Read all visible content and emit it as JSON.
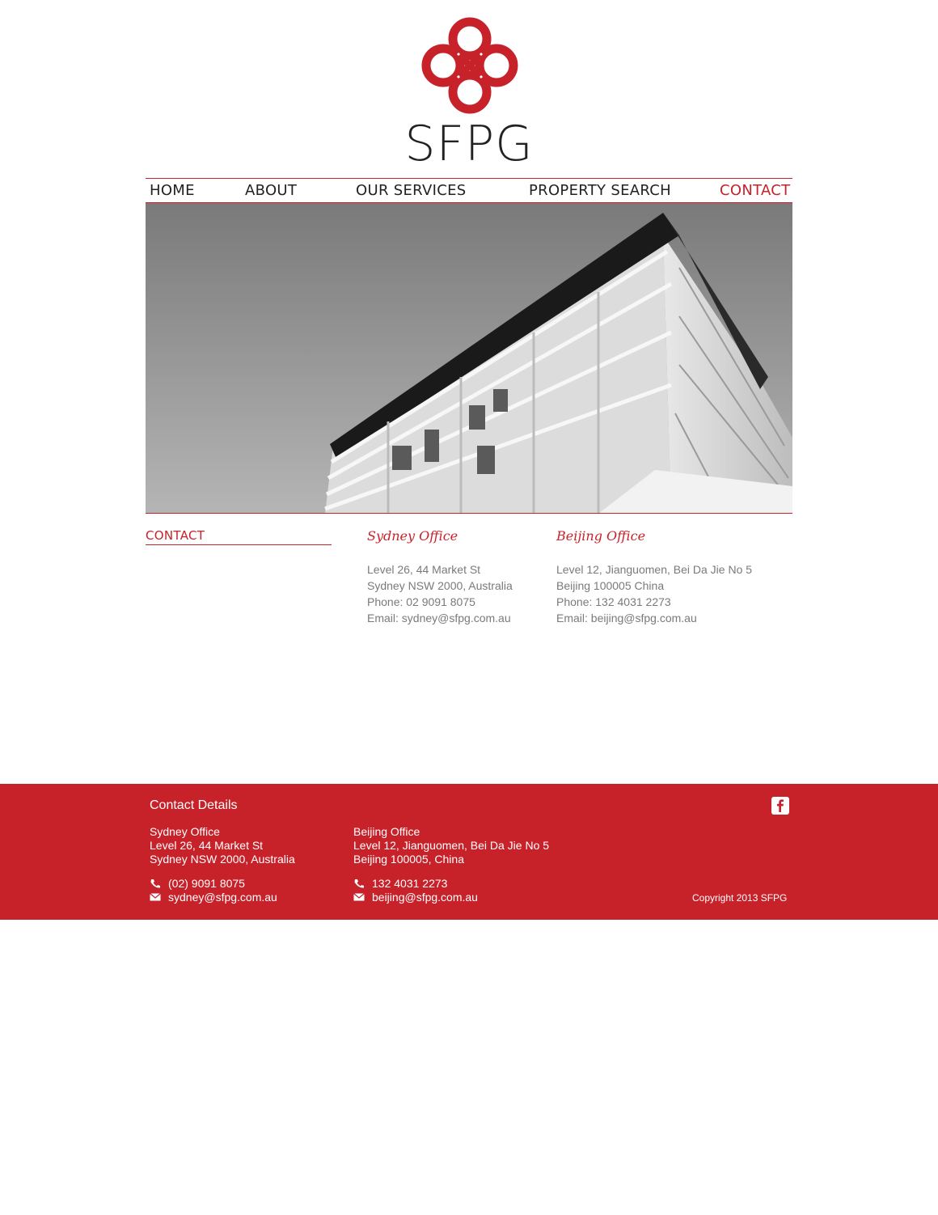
{
  "brand": {
    "name": "SFPG",
    "accent_color": "#c7212a",
    "logo_icon": "endless-knot-icon"
  },
  "nav": {
    "items": [
      {
        "label": "HOME",
        "active": false
      },
      {
        "label": "ABOUT",
        "active": false
      },
      {
        "label": "OUR  SERVICES",
        "active": false
      },
      {
        "label": "PROPERTY SEARCH",
        "active": false
      },
      {
        "label": "CONTACT",
        "active": true
      }
    ]
  },
  "hero": {
    "image": "building-photo-grayscale"
  },
  "content": {
    "section_title": "CONTACT",
    "offices": [
      {
        "name": "Sydney Office",
        "lines": [
          "Level 26, 44 Market St",
          "Sydney NSW 2000, Australia",
          "Phone: 02 9091 8075",
          "Email: sydney@sfpg.com.au"
        ]
      },
      {
        "name": "Beijing Office",
        "lines": [
          "Level 12, Jianguomen, Bei Da Jie No 5",
          "Beijing 100005 China",
          "Phone: 132 4031 2273",
          "Email: beijing@sfpg.com.au"
        ]
      }
    ]
  },
  "footer": {
    "title": "Contact Details",
    "offices": [
      {
        "name": "Sydney Office",
        "address": [
          "Level 26, 44 Market St",
          "Sydney NSW 2000, Australia"
        ],
        "phone": "(02) 9091 8075",
        "email": "sydney@sfpg.com.au"
      },
      {
        "name": "Beijing Office",
        "address": [
          "Level 12, Jianguomen, Bei Da Jie No 5",
          "Beijing 100005, China"
        ],
        "phone": "132 4031 2273",
        "email": "beijing@sfpg.com.au"
      }
    ],
    "social_icon": "facebook-icon",
    "copyright": "Copyright 2013  SFPG"
  }
}
